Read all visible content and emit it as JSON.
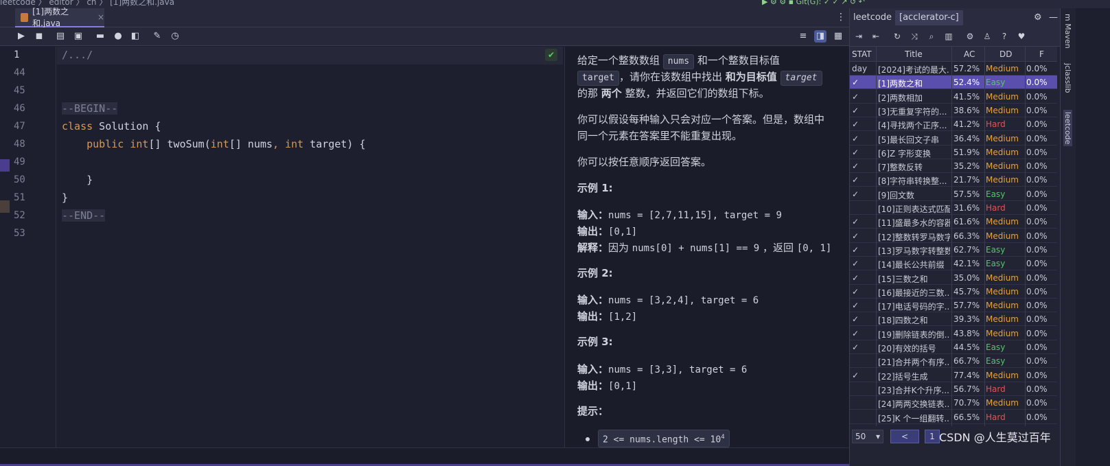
{
  "topbar": {
    "breadcrumb": "leetcode  〉 editor 〉 cn 〉 [1]两数之和.java",
    "right_text": "▶ ⚙ ⚙ ▪  Git(G): ✓ ✓ ↗ ↺ ↶"
  },
  "editor": {
    "tab_label": "[1]两数之和.java",
    "tab_close": "×",
    "toolbar_icons": [
      "run-icon",
      "submit-icon",
      "clear-icon",
      "collect-icon",
      "comment-icon",
      "hint-icon",
      "open-icon",
      "edit-icon",
      "timer-icon"
    ],
    "line_numbers": [
      "1",
      "44",
      "45",
      "46",
      "47",
      "48",
      "49",
      "50",
      "51",
      "52",
      "53"
    ],
    "code_lines": {
      "l1": "/.../",
      "l46": "--BEGIN--",
      "l47a": "class",
      "l47b": " Solution {",
      "l48a": "    public ",
      "l48b": "int",
      "l48c": "[] twoSum(",
      "l48d": "int",
      "l48e": "[] nums",
      "l48f": ", ",
      "l48g": "int",
      "l48h": " target) {",
      "l50": "    }",
      "l51": "}",
      "l52": "--END--"
    },
    "check_icon": "✔"
  },
  "description": {
    "p1_a": "给定一个整数数组 ",
    "p1_chip1": "nums",
    "p1_b": " 和一个整数目标值",
    "p1_chip2": "target",
    "p1_c": "，请你在该数组中找出 ",
    "p1_bold": "和为目标值",
    "p1_chip3": "target",
    "p1_d": "的那 ",
    "p1_bold2": "两个",
    "p1_e": " 整数，并返回它们的数组下标。",
    "p2_a": "你可以假设每种输入只会对应一个答案。但是，数组中",
    "p2_b": "同一个元素在答案里不能重复出现。",
    "p3": "你可以按任意顺序返回答案。",
    "ex1_title": "示例 1:",
    "ex1_in_label": "输入：",
    "ex1_in": "nums = [2,7,11,15], target = 9",
    "ex1_out_label": "输出：",
    "ex1_out": "[0,1]",
    "ex1_exp_label": "解释：",
    "ex1_exp_a": "因为 ",
    "ex1_exp_b": "nums[0] + nums[1] == 9",
    "ex1_exp_c": " ，返回 ",
    "ex1_exp_d": "[0, 1]",
    "ex2_title": "示例 2:",
    "ex2_in_label": "输入：",
    "ex2_in": "nums = [3,2,4], target = 6",
    "ex2_out_label": "输出：",
    "ex2_out": "[1,2]",
    "ex3_title": "示例 3:",
    "ex3_in_label": "输入：",
    "ex3_in": "nums = [3,3], target = 6",
    "ex3_out_label": "输出：",
    "ex3_out": "[0,1]",
    "hint_title": "提示：",
    "hint1": "2 <= nums.length <= 10",
    "hint1_sup": "4"
  },
  "leetcode_panel": {
    "tabs": [
      "leetcode",
      "[acclerator-c]"
    ],
    "tool_icons": [
      "login-icon",
      "logout-icon",
      "refresh-icon",
      "shuffle-icon",
      "search-icon",
      "chart-icon",
      "settings-icon",
      "clean-icon",
      "help-icon",
      "heart-icon"
    ],
    "columns": [
      "STAT",
      "Title",
      "AC",
      "DD",
      "F"
    ],
    "rows": [
      {
        "stat": "day",
        "title": "[2024]考试的最大...",
        "ac": "57.2%",
        "dd": "Medium",
        "f": "0.0%"
      },
      {
        "stat": "✓",
        "title": "[1]两数之和",
        "ac": "52.4%",
        "dd": "Easy",
        "f": "0.0%"
      },
      {
        "stat": "✓",
        "title": "[2]两数相加",
        "ac": "41.5%",
        "dd": "Medium",
        "f": "0.0%"
      },
      {
        "stat": "✓",
        "title": "[3]无重复字符的...",
        "ac": "38.6%",
        "dd": "Medium",
        "f": "0.0%"
      },
      {
        "stat": "✓",
        "title": "[4]寻找两个正序...",
        "ac": "41.2%",
        "dd": "Hard",
        "f": "0.0%"
      },
      {
        "stat": "✓",
        "title": "[5]最长回文子串",
        "ac": "36.4%",
        "dd": "Medium",
        "f": "0.0%"
      },
      {
        "stat": "✓",
        "title": "[6]Z 字形变换",
        "ac": "51.9%",
        "dd": "Medium",
        "f": "0.0%"
      },
      {
        "stat": "✓",
        "title": "[7]整数反转",
        "ac": "35.2%",
        "dd": "Medium",
        "f": "0.0%"
      },
      {
        "stat": "✓",
        "title": "[8]字符串转换整...",
        "ac": "21.7%",
        "dd": "Medium",
        "f": "0.0%"
      },
      {
        "stat": "✓",
        "title": "[9]回文数",
        "ac": "57.5%",
        "dd": "Easy",
        "f": "0.0%"
      },
      {
        "stat": "",
        "title": "[10]正则表达式匹配",
        "ac": "31.6%",
        "dd": "Hard",
        "f": "0.0%"
      },
      {
        "stat": "✓",
        "title": "[11]盛最多水的容器",
        "ac": "61.6%",
        "dd": "Medium",
        "f": "0.0%"
      },
      {
        "stat": "✓",
        "title": "[12]整数转罗马数字",
        "ac": "66.3%",
        "dd": "Medium",
        "f": "0.0%"
      },
      {
        "stat": "✓",
        "title": "[13]罗马数字转整数",
        "ac": "62.7%",
        "dd": "Easy",
        "f": "0.0%"
      },
      {
        "stat": "✓",
        "title": "[14]最长公共前缀",
        "ac": "42.1%",
        "dd": "Easy",
        "f": "0.0%"
      },
      {
        "stat": "✓",
        "title": "[15]三数之和",
        "ac": "35.0%",
        "dd": "Medium",
        "f": "0.0%"
      },
      {
        "stat": "✓",
        "title": "[16]最接近的三数...",
        "ac": "45.7%",
        "dd": "Medium",
        "f": "0.0%"
      },
      {
        "stat": "✓",
        "title": "[17]电话号码的字...",
        "ac": "57.7%",
        "dd": "Medium",
        "f": "0.0%"
      },
      {
        "stat": "✓",
        "title": "[18]四数之和",
        "ac": "39.3%",
        "dd": "Medium",
        "f": "0.0%"
      },
      {
        "stat": "✓",
        "title": "[19]删除链表的倒...",
        "ac": "43.8%",
        "dd": "Medium",
        "f": "0.0%"
      },
      {
        "stat": "✓",
        "title": "[20]有效的括号",
        "ac": "44.5%",
        "dd": "Easy",
        "f": "0.0%"
      },
      {
        "stat": "",
        "title": "[21]合并两个有序...",
        "ac": "66.7%",
        "dd": "Easy",
        "f": "0.0%"
      },
      {
        "stat": "✓",
        "title": "[22]括号生成",
        "ac": "77.4%",
        "dd": "Medium",
        "f": "0.0%"
      },
      {
        "stat": "",
        "title": "[23]合并K个升序...",
        "ac": "56.7%",
        "dd": "Hard",
        "f": "0.0%"
      },
      {
        "stat": "",
        "title": "[24]两两交换链表...",
        "ac": "70.7%",
        "dd": "Medium",
        "f": "0.0%"
      },
      {
        "stat": "",
        "title": "[25]K 个一组翻转...",
        "ac": "66.5%",
        "dd": "Hard",
        "f": "0.0%"
      }
    ],
    "selected_index": 1,
    "page_size": "50",
    "prev_label": "<",
    "page_label": "1"
  },
  "right_strip": {
    "items": [
      "m Maven",
      "jclasslib",
      "leetcode"
    ]
  },
  "watermark": "CSDN @人生莫过百年",
  "colors": {
    "accent": "#5b4fae",
    "easy": "#56c56a",
    "medium": "#e6a43a",
    "hard": "#e05555"
  }
}
